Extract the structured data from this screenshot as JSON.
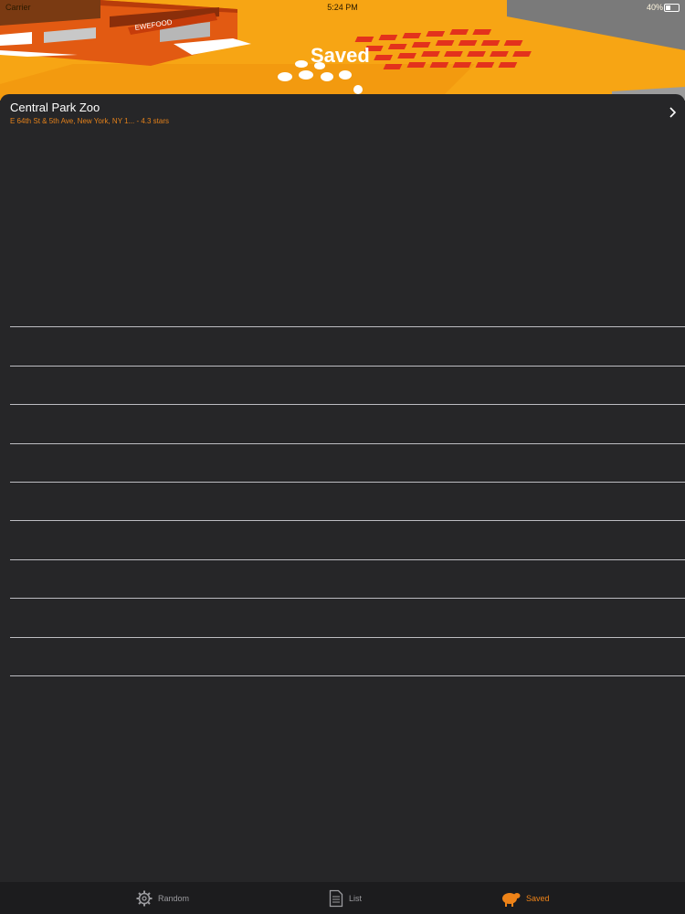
{
  "status_bar": {
    "carrier": "Carrier",
    "time": "5:24 PM",
    "battery": "40%"
  },
  "header": {
    "title": "Saved",
    "sign_text": "EWEFOOD"
  },
  "list": {
    "items": [
      {
        "title": "Central Park Zoo",
        "subtitle": "E 64th St & 5th Ave, New York, NY 1... - 4.3 stars"
      }
    ]
  },
  "tabs": [
    {
      "label": "Random",
      "icon": "gear-icon",
      "active": false
    },
    {
      "label": "List",
      "icon": "document-icon",
      "active": false
    },
    {
      "label": "Saved",
      "icon": "sheep-icon",
      "active": true
    }
  ],
  "colors": {
    "accent": "#ee8318",
    "header_bg": "#f7a514",
    "panel_bg": "#262628",
    "tabbar_bg": "#1c1c1e"
  }
}
